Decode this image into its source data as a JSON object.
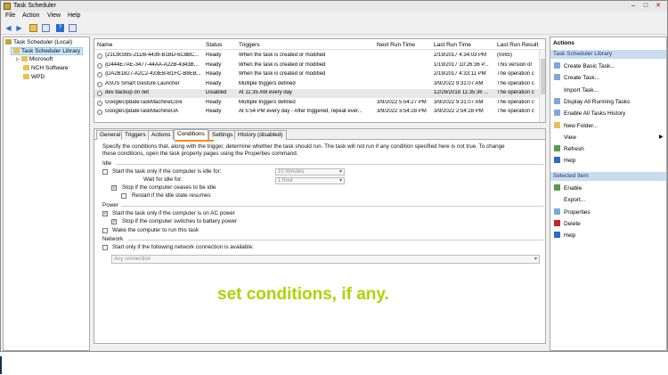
{
  "window": {
    "title": "Task Scheduler",
    "min": "–",
    "max": "□",
    "close": "✕"
  },
  "menu": [
    "File",
    "Action",
    "View",
    "Help"
  ],
  "toolbar_icons": [
    "back-icon",
    "forward-icon",
    "folder-icon",
    "refresh-icon",
    "help-icon",
    "panel-icon"
  ],
  "tree": {
    "root": "Task Scheduler (Local)",
    "library": "Task Scheduler Library",
    "children": [
      "Microsoft",
      "NCH Software",
      "WPD"
    ]
  },
  "tasklist": {
    "columns": [
      "Name",
      "Status",
      "Triggers",
      "Next Run Time",
      "Last Run Time",
      "Last Run Result"
    ],
    "rows": [
      [
        "{21C80395-21D8-4439-B1BD-6C8BC...",
        "Ready",
        "When the task is created or modified",
        "",
        "2/19/2017 4:34:03 PM",
        "(0x65)"
      ],
      [
        "{D444E7AE-3477-44AA-A22B-4343B...",
        "Ready",
        "When the task is created or modified",
        "",
        "1/19/2017 10:26:36 P...",
        "This version of"
      ],
      [
        "{DA2B1827-A2C2-433EB-B1FC-B8EB...",
        "Ready",
        "When the task is created or modified",
        "",
        "2/19/2017 4:33:11 PM",
        "The operation c"
      ],
      [
        "ASUS Smart Gesture Launcher",
        "Ready",
        "Multiple triggers defined",
        "",
        "3/9/2022 9:31:07 AM",
        "The operation c"
      ],
      [
        "dev backup on net",
        "Disabled",
        "At 11:35 AM every day",
        "",
        "12/29/2018 11:35:36 ...",
        "The operation c"
      ],
      [
        "GoogleUpdateTaskMachineCore",
        "Ready",
        "Multiple triggers defined",
        "3/9/2022 5:54:27 PM",
        "3/9/2022 9:31:07 AM",
        "The operation c"
      ],
      [
        "GoogleUpdateTaskMachineUA",
        "Ready",
        "At 5:54 PM every day - After triggered, repeat ever...",
        "3/9/2022 3:54:28 PM",
        "3/9/2022 2:54:28 PM",
        "The operation c"
      ]
    ]
  },
  "tabs": [
    "General",
    "Triggers",
    "Actions",
    "Conditions",
    "Settings",
    "History (disabled)"
  ],
  "conditions": {
    "intro1": "Specify the conditions that, along with the trigger, determine whether the task should run.  The task will not run  if any condition specified here is not true.  To change",
    "intro2": "these conditions, open the task property pages using the Properties command.",
    "idle_label": "Idle",
    "idle_start": "Start the task only if the computer is idle for:",
    "idle_wait": "Wait for idle for:",
    "idle_stop": "Stop if the computer ceases to be idle",
    "idle_restart": "Restart if the idle state resumes",
    "idle_duration": "10 minutes",
    "idle_wait_value": "1 hour",
    "power_label": "Power",
    "power_ac": "Start the task only if the computer is on AC power",
    "power_battery": "Stop if the computer switches to battery power",
    "power_wake": "Wake the computer to run this task",
    "network_label": "Network",
    "network_start": "Start only if the following network connection is available:",
    "network_value": "Any connection"
  },
  "caption": "set conditions, if any.",
  "actions": {
    "header": "Actions",
    "library_header": "Task Scheduler Library",
    "library_items": [
      "Create Basic Task...",
      "Create Task...",
      "Import Task...",
      "Display All Running Tasks",
      "Enable All Tasks History",
      "New Folder...",
      "View",
      "Refresh",
      "Help"
    ],
    "selected_header": "Selected Item",
    "selected_items": [
      "Enable",
      "Export...",
      "Properties",
      "Delete",
      "Help"
    ]
  },
  "colors": {
    "caption": "#a8d600",
    "tab_underline": "#ff8a1e",
    "action_header": "#c9dcf0"
  }
}
